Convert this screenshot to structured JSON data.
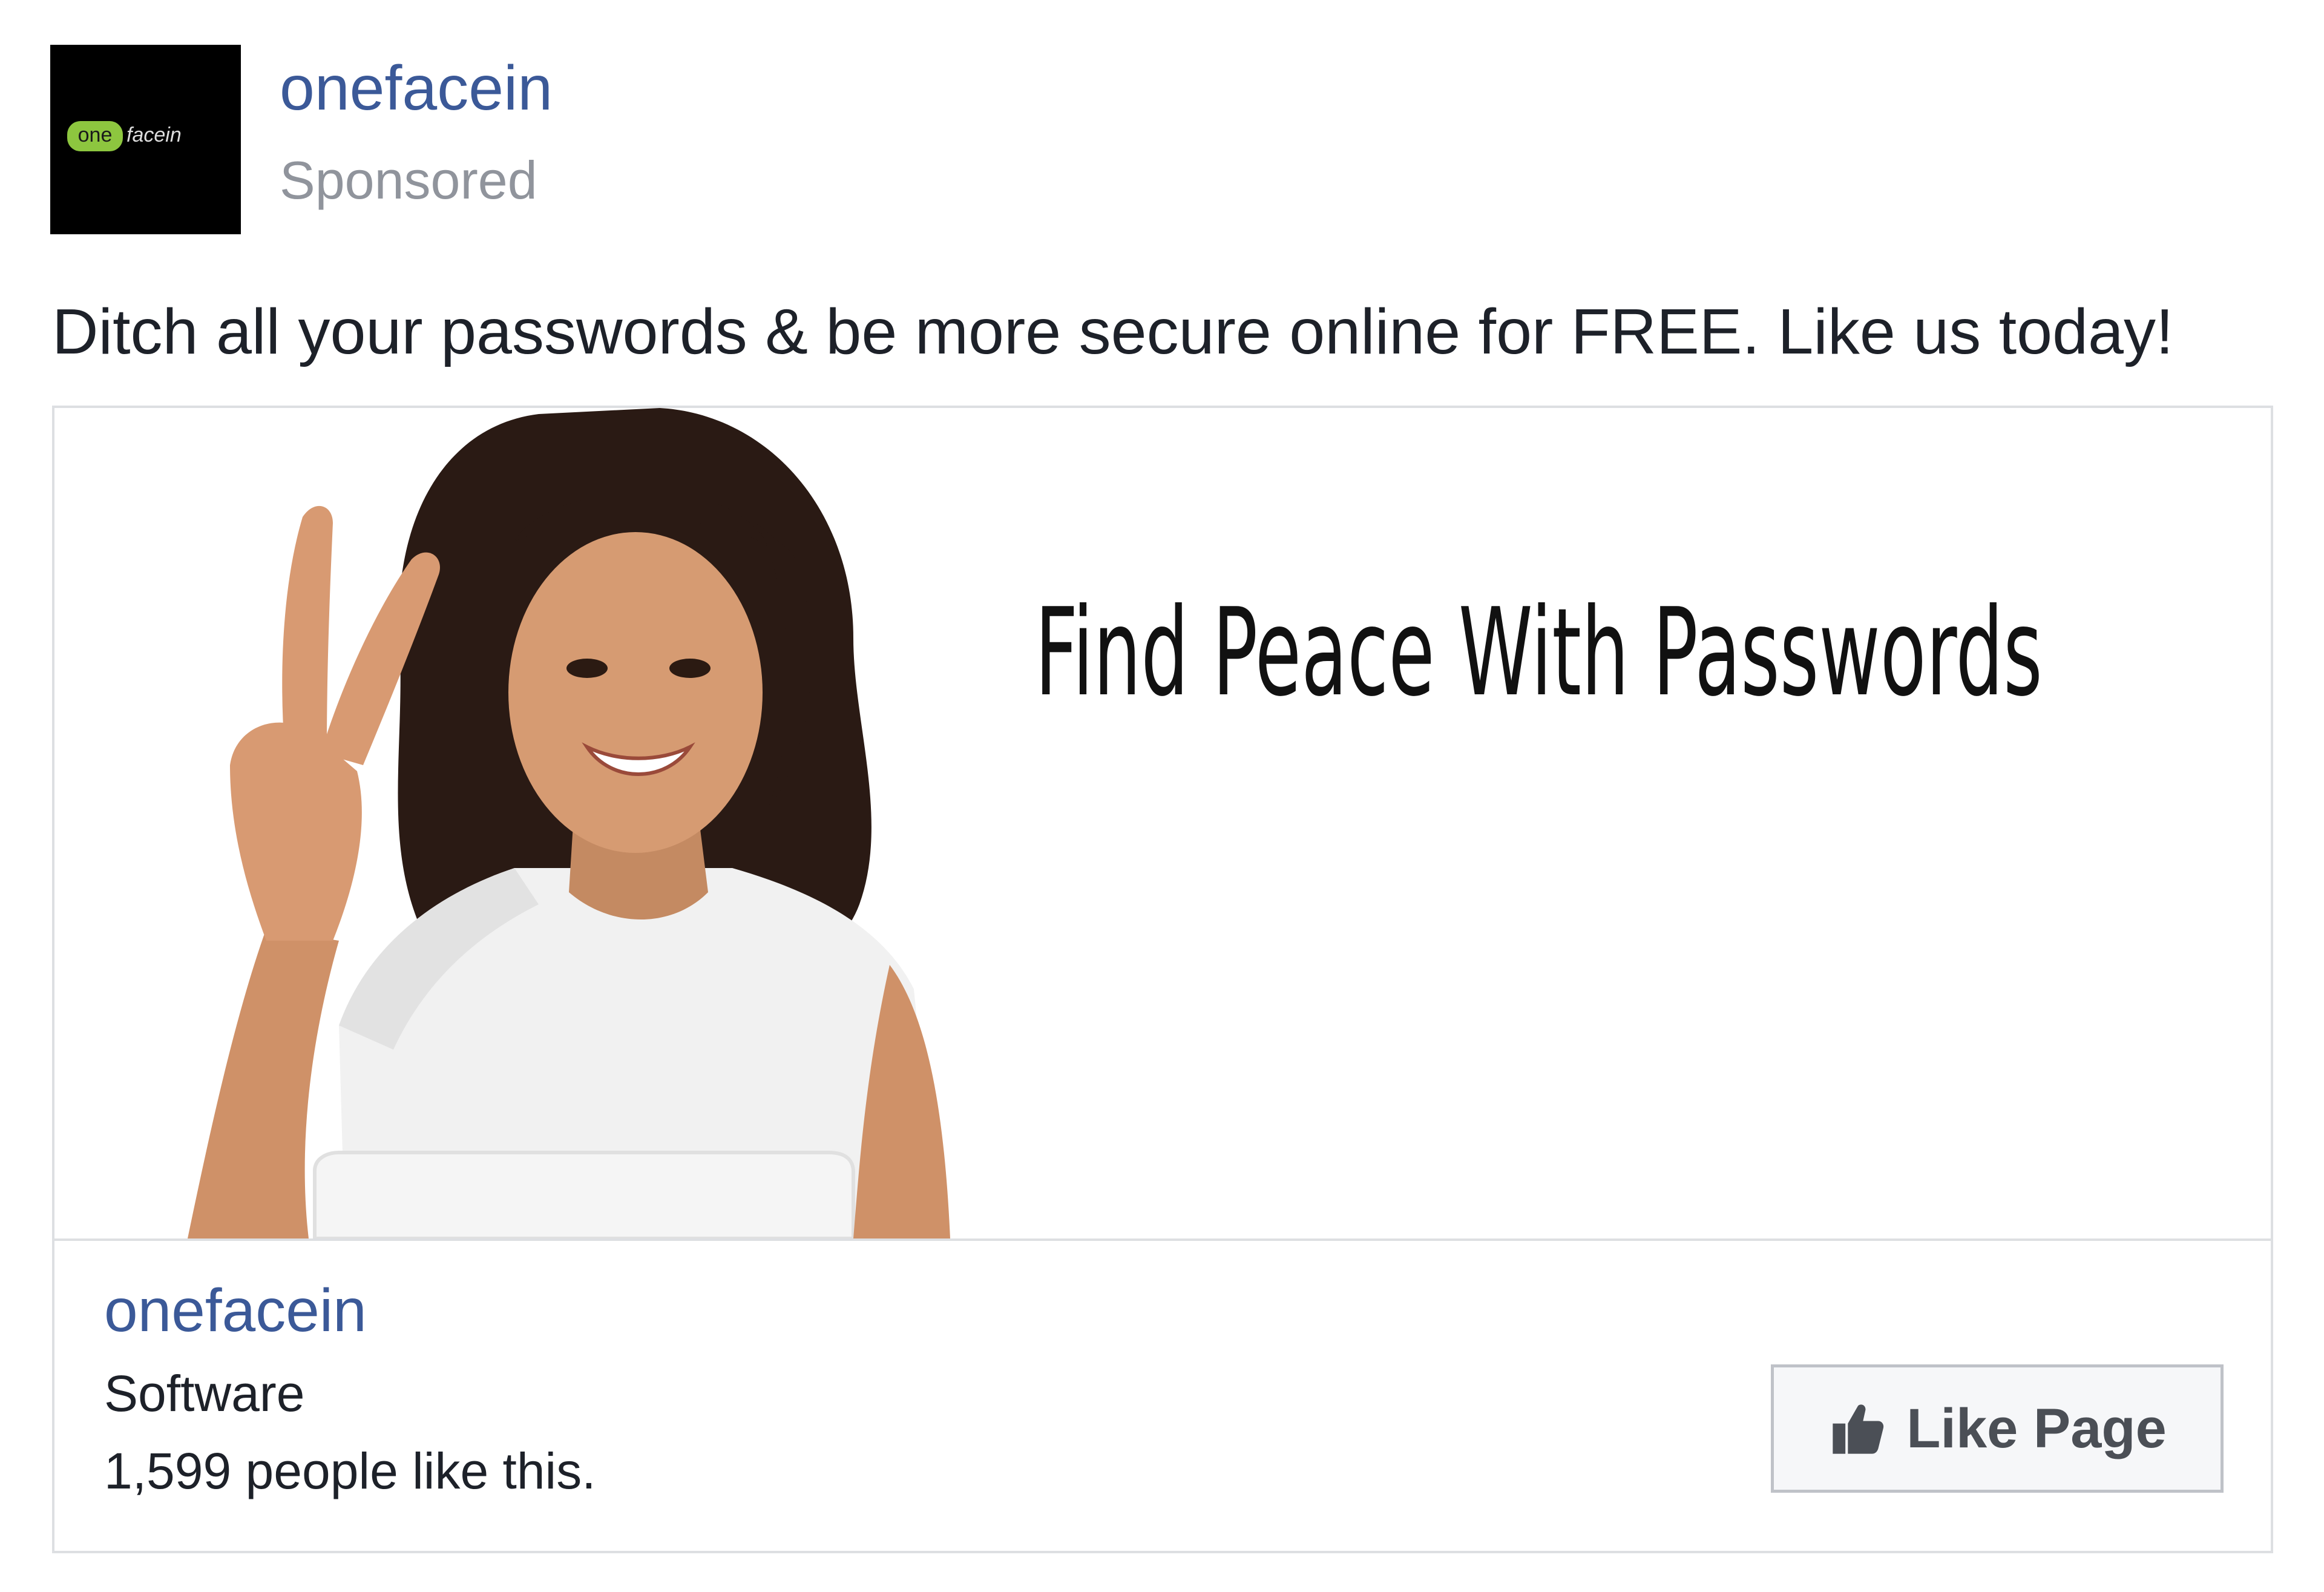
{
  "post": {
    "page_name": "onefacein",
    "sponsored_label": "Sponsored",
    "logo": {
      "icon": "onefacein-logo-icon",
      "text_one": "one",
      "text_face": "facein",
      "badge_color": "#8dc63f"
    },
    "text": "Ditch all your passwords & be more secure online for FREE. Like us today!"
  },
  "card": {
    "headline": "Find Peace With Passwords",
    "page_name": "onefacein",
    "category": "Software",
    "likes_text": "1,599 people like this.",
    "like_button": {
      "icon": "thumbs-up-icon",
      "label": "Like Page"
    }
  },
  "colors": {
    "link_blue": "#3b5998",
    "muted_gray": "#90949c",
    "text_dark": "#1d2129",
    "border": "#dddfe2"
  }
}
